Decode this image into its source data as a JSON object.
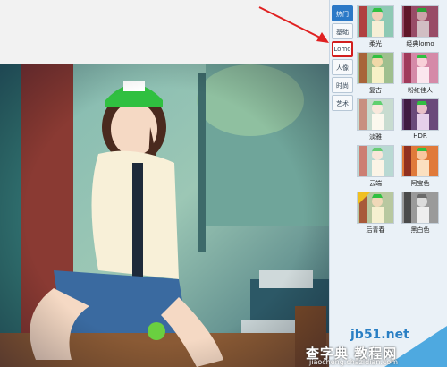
{
  "tabs": [
    {
      "label": "热门",
      "active": true
    },
    {
      "label": "基础",
      "active": false
    },
    {
      "label": "Lomo",
      "active": false,
      "highlighted": true
    },
    {
      "label": "人像",
      "active": false
    },
    {
      "label": "时尚",
      "active": false
    },
    {
      "label": "艺术",
      "active": false
    }
  ],
  "filters": [
    {
      "label": "柔光"
    },
    {
      "label": "经典lomo"
    },
    {
      "label": "复古"
    },
    {
      "label": "粉红佳人"
    },
    {
      "label": "淡雅"
    },
    {
      "label": "HDR"
    },
    {
      "label": "云端"
    },
    {
      "label": "阿宝色"
    },
    {
      "label": "后青春"
    },
    {
      "label": "黑白色"
    }
  ],
  "watermark": {
    "line1": "jb51.net",
    "line2": "查字典 教程网",
    "line3": "jiaocheng.chazidian.com"
  },
  "colors": {
    "accent": "#2b79c7",
    "highlight_border": "#d21e1e",
    "arrow": "#e02020"
  }
}
